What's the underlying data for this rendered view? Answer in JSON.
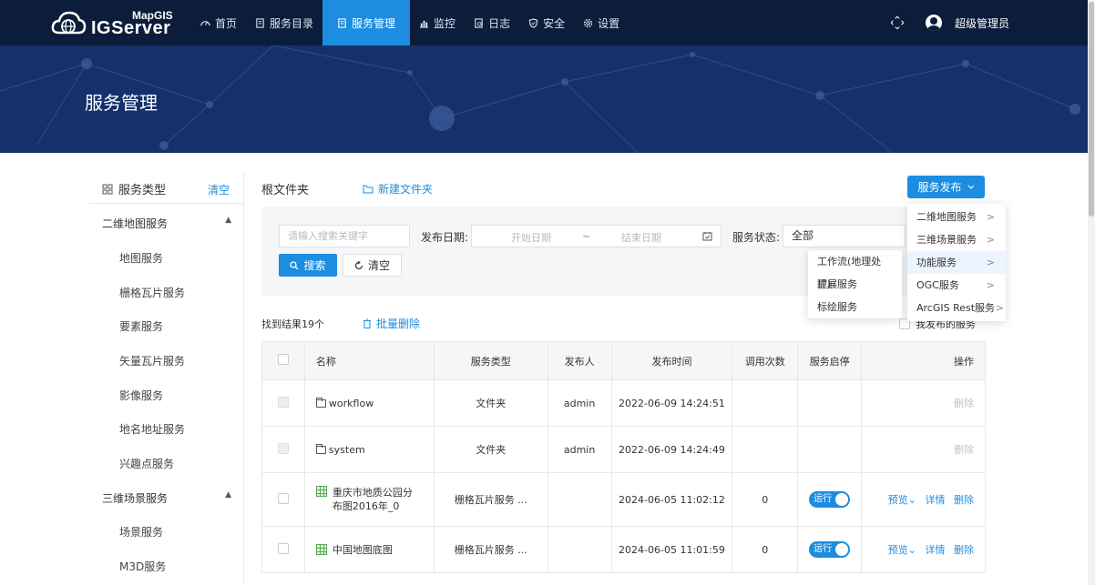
{
  "brand": {
    "small": "MapGIS",
    "big": "IGServer"
  },
  "nav": [
    {
      "label": "首页",
      "icon": "dashboard-icon"
    },
    {
      "label": "服务目录",
      "icon": "document-icon"
    },
    {
      "label": "服务管理",
      "icon": "document-icon",
      "active": true
    },
    {
      "label": "监控",
      "icon": "bar-chart-icon"
    },
    {
      "label": "日志",
      "icon": "log-icon"
    },
    {
      "label": "安全",
      "icon": "shield-icon"
    },
    {
      "label": "设置",
      "icon": "gear-icon"
    }
  ],
  "user": {
    "name": "超级管理员"
  },
  "banner": {
    "title": "服务管理"
  },
  "sidebar": {
    "title": "服务类型",
    "clear": "清空",
    "groups": [
      {
        "label": "二维地图服务",
        "items": [
          "地图服务",
          "栅格瓦片服务",
          "要素服务",
          "矢量瓦片服务",
          "影像服务",
          "地名地址服务",
          "兴趣点服务"
        ]
      },
      {
        "label": "三维场景服务",
        "items": [
          "场景服务",
          "M3D服务"
        ]
      }
    ]
  },
  "main": {
    "breadcrumb": "根文件夹",
    "new_folder": "新建文件夹",
    "publish": "服务发布"
  },
  "filter": {
    "search_placeholder": "请输入搜索关键字",
    "date_label": "发布日期:",
    "start_date": "开始日期",
    "date_sep": "~",
    "end_date": "结束日期",
    "status_label": "服务状态:",
    "status_value": "全部",
    "search_btn": "搜索",
    "clear_btn": "清空"
  },
  "results": {
    "count": "找到结果19个",
    "batch_delete": "批量删除",
    "my_published": "我发布的服务"
  },
  "table": {
    "headers": [
      "名称",
      "服务类型",
      "发布人",
      "发布时间",
      "调用次数",
      "服务启停",
      "操作"
    ],
    "rows": [
      {
        "name": "workflow",
        "type": "文件夹",
        "publisher": "admin",
        "time": "2022-06-09 14:24:51",
        "calls": "",
        "ops_delete": "删除"
      },
      {
        "name": "system",
        "type": "文件夹",
        "publisher": "admin",
        "time": "2022-06-09 14:24:49",
        "calls": "",
        "ops_delete": "删除"
      },
      {
        "name": "重庆市地质公园分布图2016年_0",
        "type": "栅格瓦片服务 ...",
        "publisher": "",
        "time": "2024-06-05 11:02:12",
        "calls": "0",
        "status": "运行",
        "ops_preview": "预览",
        "ops_detail": "详情",
        "ops_delete": "删除"
      },
      {
        "name": "中国地图底图",
        "type": "栅格瓦片服务 ...",
        "publisher": "",
        "time": "2024-06-05 11:01:59",
        "calls": "0",
        "status": "运行",
        "ops_preview": "预览",
        "ops_detail": "详情",
        "ops_delete": "删除"
      }
    ]
  },
  "publish_menu": [
    "二维地图服务",
    "三维场景服务",
    "功能服务",
    "OGC服务",
    "ArcGIS Rest服务"
  ],
  "function_submenu": [
    "工作流(地理处理)",
    "扩展服务",
    "标绘服务"
  ],
  "colors": {
    "nav_bg": "#0b1d3a",
    "accent": "#1c8de0",
    "banner_bg": "#15306a"
  }
}
